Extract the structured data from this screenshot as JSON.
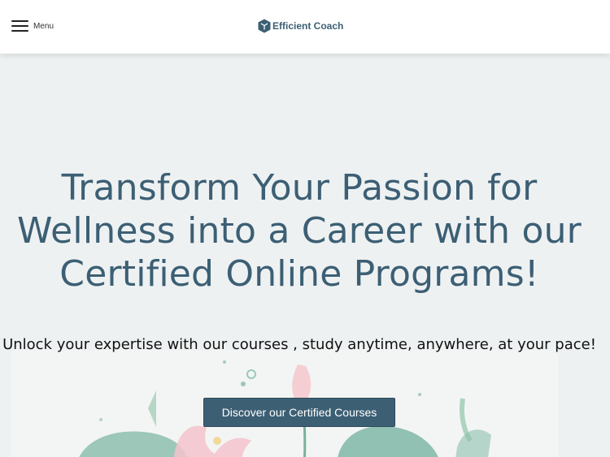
{
  "header": {
    "menu_label": "Menu",
    "logo_text": "Efficient Coach",
    "brand_color": "#3c5f74"
  },
  "hero": {
    "title": "Transform Your Passion for Wellness into a Career with our Certified Online Programs!",
    "subtitle": "Unlock your expertise with our courses , study anytime, anywhere, at your pace!",
    "cta_label": "Discover our Certified Courses",
    "background_color": "#eef1f2",
    "illustration": "watercolor-lotus-flowers"
  }
}
